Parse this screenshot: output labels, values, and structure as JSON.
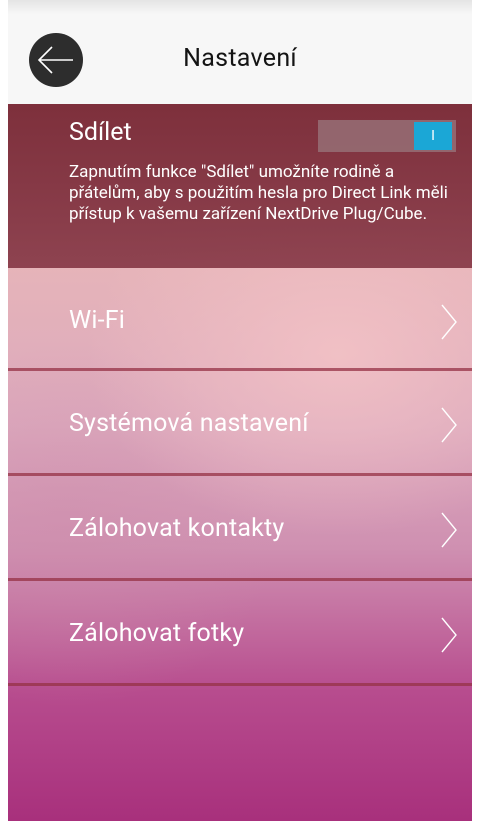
{
  "header": {
    "title": "Nastavení",
    "back_icon": "arrow-left-icon"
  },
  "share": {
    "title": "Sdílet",
    "description": "Zapnutím funkce \"Sdílet\" umožníte rodině a přátelům, aby s použitím hesla pro Direct Link měli přístup k vašemu zařízení NextDrive Plug/Cube.",
    "toggle_state_label": "I",
    "toggle_on": true,
    "toggle_color": "#1ba7d6"
  },
  "menu": {
    "items": [
      {
        "label": "Wi-Fi"
      },
      {
        "label": "Systémová nastavení"
      },
      {
        "label": "Zálohovat kontakty"
      },
      {
        "label": "Zálohovat fotky"
      }
    ],
    "chevron_icon": "chevron-right-icon"
  },
  "colors": {
    "header_bg": "#f7f7f7",
    "share_bg": "#7a2a36",
    "divider": "#963246",
    "bottom_gradient": "#a8307c"
  }
}
